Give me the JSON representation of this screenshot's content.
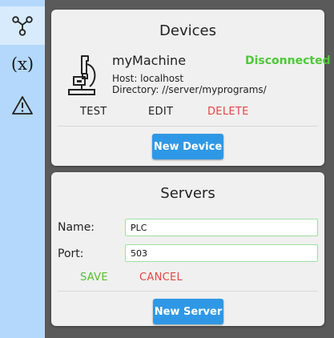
{
  "sidebar": {
    "items": [
      {
        "name": "devices",
        "icon": "network-nodes-icon",
        "active": true
      },
      {
        "name": "variables",
        "label": "(x)",
        "active": false
      },
      {
        "name": "alerts",
        "icon": "warning-triangle-icon",
        "active": false
      }
    ]
  },
  "devices": {
    "title": "Devices",
    "device": {
      "icon": "microscope-icon",
      "name": "myMachine",
      "status": "Disconnected",
      "host": "Host: localhost",
      "directory": "Directory: //server/myprograms/",
      "actions": {
        "test": "TEST",
        "edit": "EDIT",
        "delete": "DELETE"
      }
    },
    "new_button": "New Device"
  },
  "servers": {
    "title": "Servers",
    "name_label": "Name:",
    "name_value": "PLC",
    "port_label": "Port:",
    "port_value": "503",
    "save_label": "SAVE",
    "cancel_label": "CANCEL",
    "new_button": "New Server"
  },
  "colors": {
    "sidebar": "#b4d8fb",
    "sidebar_active": "#d7ebfd",
    "status_ok": "#4fc73a",
    "danger": "#e64545",
    "save": "#56bf2a",
    "primary": "#2f98e6"
  }
}
